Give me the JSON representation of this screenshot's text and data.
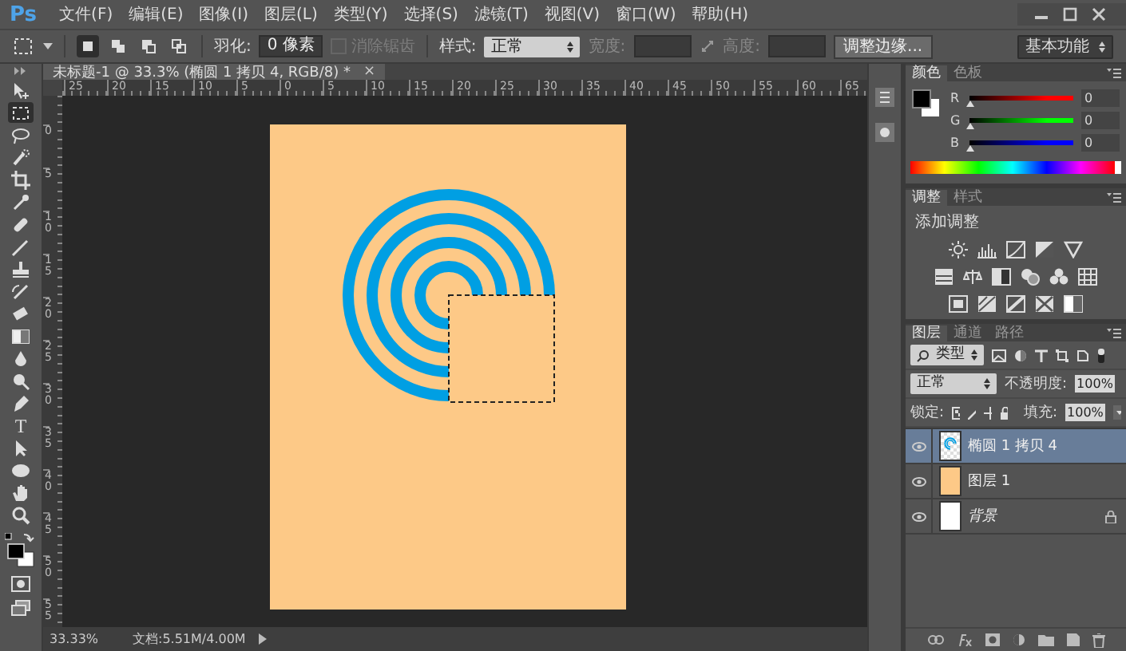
{
  "app": {
    "logo": "Ps"
  },
  "menu": [
    "文件(F)",
    "编辑(E)",
    "图像(I)",
    "图层(L)",
    "类型(Y)",
    "选择(S)",
    "滤镜(T)",
    "视图(V)",
    "窗口(W)",
    "帮助(H)"
  ],
  "options_bar": {
    "modes": [
      {
        "selected": true
      },
      {
        "selected": false
      },
      {
        "selected": false
      },
      {
        "selected": false
      }
    ],
    "feather_label": "羽化:",
    "feather_value": "0 像素",
    "antialias": {
      "label": "消除锯齿",
      "disabled": true,
      "checked": false
    },
    "style_label": "样式:",
    "style_value": "正常",
    "width_label": "宽度:",
    "height_label": "高度:",
    "refine_button": "调整边缘...",
    "workspace": "基本功能"
  },
  "document": {
    "tab_title": "未标题-1 @ 33.3% (椭圆 1 拷贝 4, RGB/8) *",
    "close": "×",
    "h_ruler": [
      "25",
      "20",
      "15",
      "10",
      "5",
      "0",
      "5",
      "10",
      "15",
      "20",
      "25",
      "30",
      "35",
      "40",
      "45",
      "50",
      "55",
      "60",
      "65"
    ],
    "v_ruler": [
      "0",
      "5",
      "10",
      "15",
      "20",
      "25",
      "30",
      "35",
      "40",
      "45",
      "50",
      "55"
    ],
    "zoom": "33.33%",
    "doc_size": "文档:5.51M/4.00M"
  },
  "tools": [
    {
      "kind": "move",
      "selected": false
    },
    {
      "kind": "marquee",
      "selected": true
    },
    {
      "kind": "lasso",
      "selected": false
    },
    {
      "kind": "quick-select",
      "selected": false
    },
    {
      "kind": "crop",
      "selected": false
    },
    {
      "kind": "eyedropper",
      "selected": false
    },
    {
      "kind": "healing",
      "selected": false
    },
    {
      "kind": "brush",
      "selected": false
    },
    {
      "kind": "stamp",
      "selected": false
    },
    {
      "kind": "history-brush",
      "selected": false
    },
    {
      "kind": "eraser",
      "selected": false
    },
    {
      "kind": "gradient",
      "selected": false
    },
    {
      "kind": "blur",
      "selected": false
    },
    {
      "kind": "dodge",
      "selected": false
    },
    {
      "kind": "pen",
      "selected": false
    },
    {
      "kind": "type",
      "glyph": "T",
      "selected": false
    },
    {
      "kind": "path-select",
      "selected": false
    },
    {
      "kind": "ellipse",
      "selected": false
    },
    {
      "kind": "hand",
      "selected": false
    },
    {
      "kind": "zoom",
      "selected": false
    }
  ],
  "color_panel": {
    "tabs": [
      {
        "label": "颜色",
        "selected": true
      },
      {
        "label": "色板",
        "selected": false
      }
    ],
    "channels": [
      {
        "name": "R",
        "color": "#ff0000",
        "level": 0,
        "reading": "0"
      },
      {
        "name": "G",
        "color": "#00ff00",
        "level": 0,
        "reading": "0"
      },
      {
        "name": "B",
        "color": "#0000ff",
        "level": 0,
        "reading": "0"
      }
    ]
  },
  "adjustments_panel": {
    "tabs": [
      {
        "label": "调整",
        "selected": true
      },
      {
        "label": "样式",
        "selected": false
      }
    ],
    "title": "添加调整"
  },
  "layers_panel": {
    "tabs": [
      {
        "label": "图层",
        "selected": true
      },
      {
        "label": "通道",
        "selected": false
      },
      {
        "label": "路径",
        "selected": false
      }
    ],
    "filter": "类型",
    "blend_mode": "正常",
    "opacity_label": "不透明度:",
    "opacity": "100%",
    "lock_label": "锁定:",
    "fill_label": "填充:",
    "fill": "100%",
    "layers": [
      {
        "name": "椭圆 1 拷贝 4",
        "kind": "shape",
        "selected": true,
        "visible": true,
        "locked": false
      },
      {
        "name": "图层 1",
        "kind": "fill",
        "selected": false,
        "visible": true,
        "locked": false
      },
      {
        "name": "背景",
        "kind": "background",
        "selected": false,
        "visible": true,
        "locked": true
      }
    ]
  }
}
